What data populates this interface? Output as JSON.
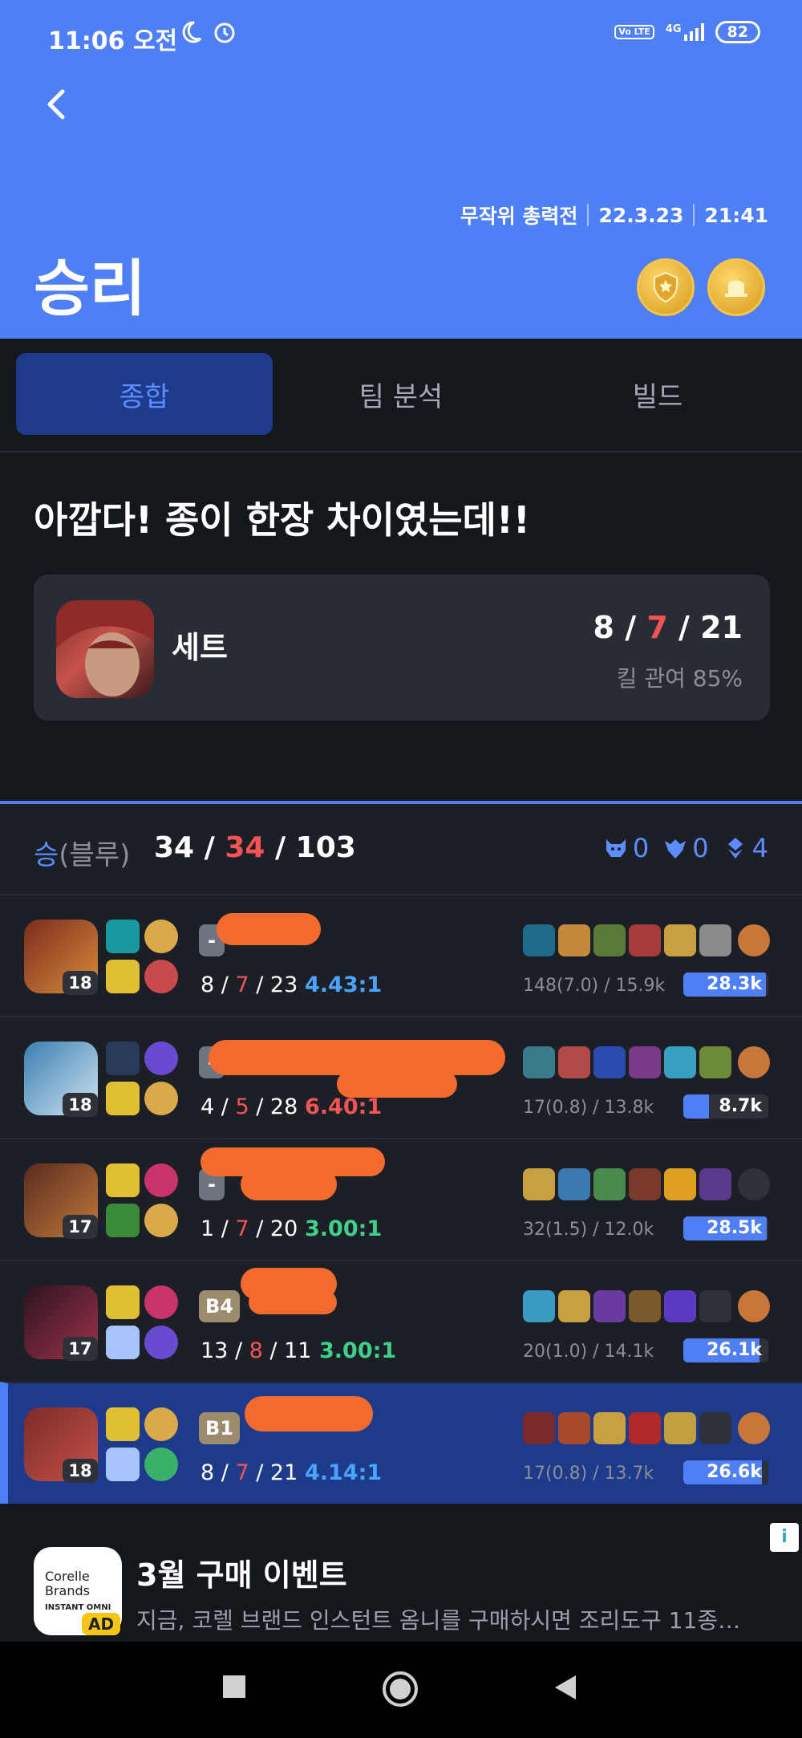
{
  "status": {
    "time": "11:06 오전",
    "network": "4G",
    "volte": "Vo LTE",
    "battery": "82"
  },
  "header": {
    "mode": "무작위 총력전",
    "date": "22.3.23",
    "time": "21:41",
    "result": "승리"
  },
  "tabs": [
    "종합",
    "팀 분석",
    "빌드"
  ],
  "summary": {
    "headline": "아깝다! 종이 한장 차이였는데!!",
    "champion": "세트",
    "kills": "8",
    "deaths": "7",
    "assists": "21",
    "kill_participation": "킬 관여 85%"
  },
  "team": {
    "label": "승",
    "side": "(블루)",
    "kills": "34",
    "deaths": "34",
    "assists": "103",
    "objectives": {
      "baron": "0",
      "dragon": "0",
      "herald": "4"
    }
  },
  "players": [
    {
      "level": "18",
      "tier": "-",
      "kills": "8",
      "deaths": "7",
      "assists": "23",
      "ratio": "4.43:1",
      "ratio_color": "#4aa3ff",
      "cs": "148(7.0) / 15.9k",
      "damage": "28.3k",
      "damage_share": 0.97,
      "champ_color": [
        "#7b2d1e",
        "#d98a3a"
      ]
    },
    {
      "level": "18",
      "tier": "-",
      "kills": "4",
      "deaths": "5",
      "assists": "28",
      "ratio": "6.40:1",
      "ratio_color": "#f05454",
      "cs": "17(0.8) / 13.8k",
      "damage": "8.7k",
      "damage_share": 0.3,
      "champ_color": [
        "#3b7fb0",
        "#cfe4f2"
      ]
    },
    {
      "level": "17",
      "tier": "-",
      "kills": "1",
      "deaths": "7",
      "assists": "20",
      "ratio": "3.00:1",
      "ratio_color": "#3fd18a",
      "cs": "32(1.5) / 12.0k",
      "damage": "28.5k",
      "damage_share": 0.98,
      "champ_color": [
        "#5a2c1f",
        "#c0773a"
      ]
    },
    {
      "level": "17",
      "tier": "B4",
      "kills": "13",
      "deaths": "8",
      "assists": "11",
      "ratio": "3.00:1",
      "ratio_color": "#3fd18a",
      "cs": "20(1.0) / 14.1k",
      "damage": "26.1k",
      "damage_share": 0.9,
      "champ_color": [
        "#2a1420",
        "#a0324a"
      ]
    },
    {
      "level": "18",
      "tier": "B1",
      "kills": "8",
      "deaths": "7",
      "assists": "21",
      "ratio": "4.14:1",
      "ratio_color": "#4aa3ff",
      "cs": "17(0.8) / 13.7k",
      "damage": "26.6k",
      "damage_share": 0.92,
      "champ_color": [
        "#7a2b28",
        "#c7534a"
      ]
    }
  ],
  "ad": {
    "brand_line1": "Corelle",
    "brand_line2": "Brands",
    "brand_line3": "INSTANT OMNI",
    "badge": "AD",
    "title": "3월 구매 이벤트",
    "body": "지금, 코렐 브랜드 인스턴트 옴니를 구매하시면 조리도구 11종…",
    "info": "i"
  },
  "icons": [
    "back-icon",
    "moon-icon",
    "alarm-icon",
    "baron-icon",
    "dragon-icon",
    "herald-icon",
    "stop-icon",
    "home-icon",
    "back-triangle-icon"
  ]
}
